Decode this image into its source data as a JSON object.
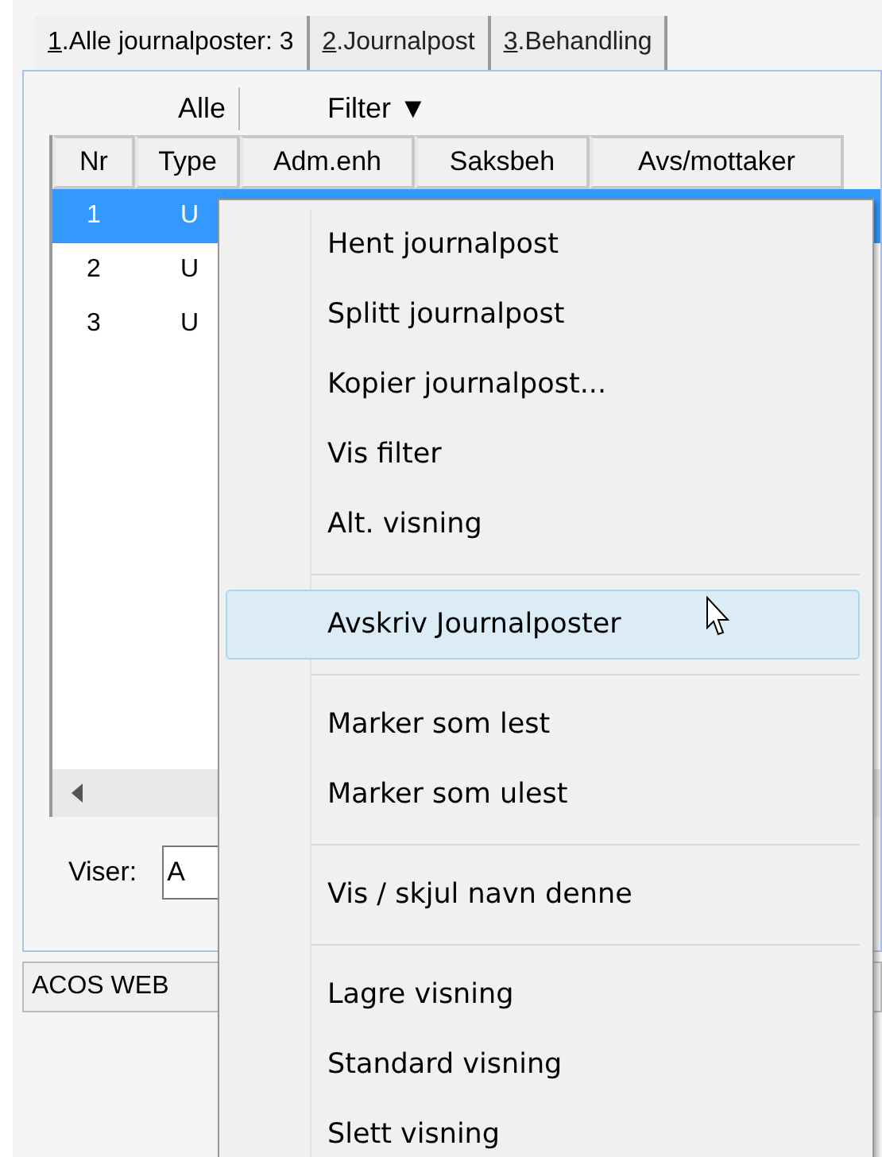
{
  "tabs": [
    {
      "key": "1",
      "label": ".Alle journalposter:  3",
      "selected": true
    },
    {
      "key": "2",
      "label": ".Journalpost",
      "selected": false
    },
    {
      "key": "3",
      "label": ".Behandling",
      "selected": false
    }
  ],
  "grid": {
    "group_headers": [
      "Alle",
      "Filter ▼"
    ],
    "columns": [
      "Nr",
      "Type",
      "Adm.enh",
      "Saksbeh",
      "Avs/mottaker"
    ],
    "rows": [
      {
        "nr": "1",
        "type": "U",
        "selected": true
      },
      {
        "nr": "2",
        "type": "U",
        "selected": false
      },
      {
        "nr": "3",
        "type": "U",
        "selected": false
      }
    ]
  },
  "viser": {
    "label": "Viser:",
    "value": "A"
  },
  "status_bar": "ACOS WEB",
  "context_menu": [
    [
      {
        "label": "Hent journalpost",
        "selected": false
      },
      {
        "label": "Splitt journalpost",
        "selected": false
      },
      {
        "label": "Kopier journalpost...",
        "selected": false
      },
      {
        "label": "Vis filter",
        "selected": false
      },
      {
        "label": "Alt. visning",
        "selected": false
      }
    ],
    [
      {
        "label": "Avskriv Journalposter",
        "selected": true
      }
    ],
    [
      {
        "label": "Marker som lest",
        "selected": false
      },
      {
        "label": "Marker som ulest",
        "selected": false
      }
    ],
    [
      {
        "label": "Vis / skjul navn denne",
        "selected": false
      }
    ],
    [
      {
        "label": "Lagre visning",
        "selected": false
      },
      {
        "label": "Standard visning",
        "selected": false
      },
      {
        "label": "Slett visning",
        "selected": false
      }
    ]
  ]
}
